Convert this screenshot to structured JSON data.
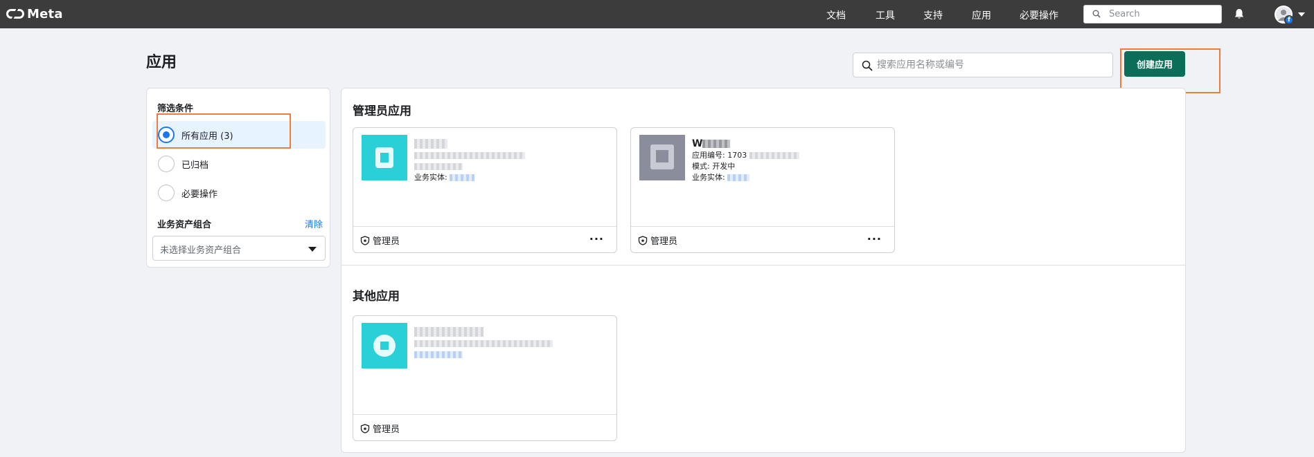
{
  "topbar": {
    "brand": "Meta",
    "nav": [
      "文档",
      "工具",
      "支持",
      "应用",
      "必要操作"
    ],
    "search_placeholder": "Search"
  },
  "page": {
    "title": "应用",
    "search_placeholder": "搜索应用名称或编号",
    "create_button": "创建应用"
  },
  "filters": {
    "title": "筛选条件",
    "options": [
      {
        "label": "所有应用 (3)",
        "selected": true
      },
      {
        "label": "已归档",
        "selected": false
      },
      {
        "label": "必要操作",
        "selected": false
      }
    ],
    "portfolio_label": "业务资产组合",
    "clear_label": "清除",
    "portfolio_select_value": "未选择业务资产组合"
  },
  "sections": {
    "admin_title": "管理员应用",
    "other_title": "其他应用"
  },
  "cards": [
    {
      "name": "",
      "app_id_label": "",
      "mode_label": "",
      "business_label": "业务实体:",
      "role": "管理员",
      "icon_color": "#2ad0d8",
      "has_more": true
    },
    {
      "name": "W",
      "app_id_label": "应用编号: 1703",
      "mode_label": "模式: 开发中",
      "business_label": "业务实体:",
      "role": "管理员",
      "icon_color": "#8a8d9c",
      "has_more": true
    },
    {
      "name": "",
      "app_id_label": "",
      "mode_label": "",
      "business_label": "",
      "role": "管理员",
      "icon_color": "#2ad0d8",
      "has_more": false
    }
  ],
  "colors": {
    "topbar": "#3c3c3c",
    "primary_button": "#0a6e58",
    "link": "#1877f2",
    "highlight": "#f07c3b"
  }
}
